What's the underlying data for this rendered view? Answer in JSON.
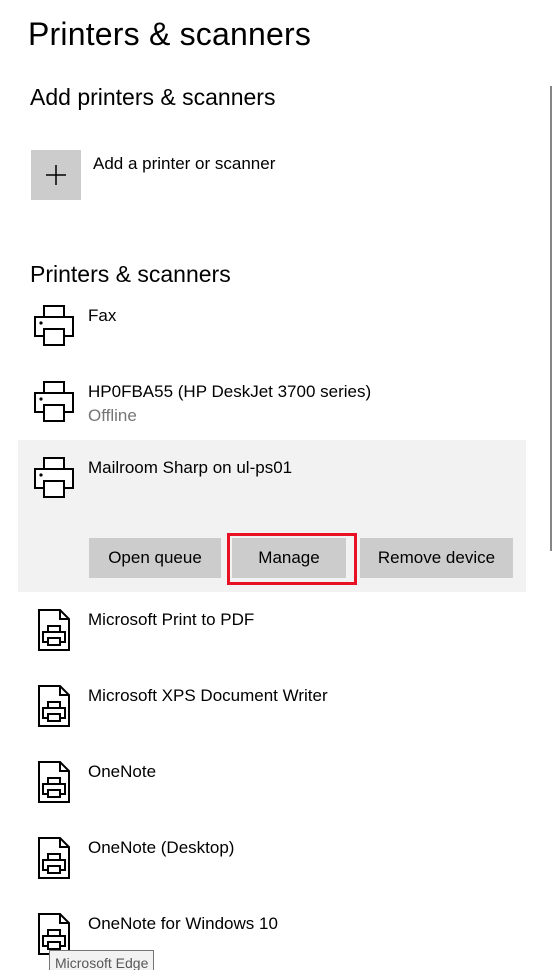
{
  "page": {
    "title": "Printers & scanners"
  },
  "add_section": {
    "heading": "Add printers & scanners",
    "add_label": "Add a printer or scanner"
  },
  "devices_section": {
    "heading": "Printers & scanners",
    "devices": [
      {
        "name": "Fax",
        "status": "",
        "icon": "printer-icon"
      },
      {
        "name": "HP0FBA55 (HP DeskJet 3700 series)",
        "status": "Offline",
        "icon": "printer-icon"
      },
      {
        "name": "Mailroom Sharp on ul-ps01",
        "status": "",
        "icon": "printer-icon",
        "selected": true
      },
      {
        "name": "Microsoft Print to PDF",
        "status": "",
        "icon": "document-printer-icon"
      },
      {
        "name": "Microsoft XPS Document Writer",
        "status": "",
        "icon": "document-printer-icon"
      },
      {
        "name": "OneNote",
        "status": "",
        "icon": "document-printer-icon"
      },
      {
        "name": "OneNote (Desktop)",
        "status": "",
        "icon": "document-printer-icon"
      },
      {
        "name": "OneNote for Windows 10",
        "status": "",
        "icon": "document-printer-icon"
      }
    ],
    "actions": {
      "open_queue": "Open queue",
      "manage": "Manage",
      "remove_device": "Remove device"
    }
  },
  "tooltip": {
    "text": "Microsoft Edge"
  },
  "colors": {
    "selected_row": "#f2f2f2",
    "button": "#cccccc",
    "highlight": "#e81123",
    "secondary_text": "#767676"
  }
}
